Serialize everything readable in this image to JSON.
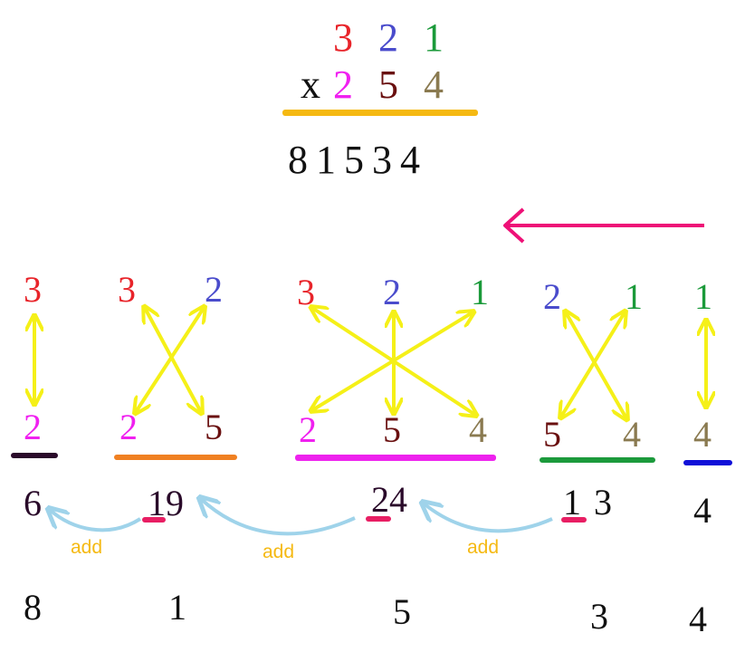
{
  "problem": {
    "top_digits": [
      "3",
      "2",
      "1"
    ],
    "times_sign": "x",
    "bottom_digits": [
      "2",
      "5",
      "4"
    ],
    "result": "8 1 5 3 4"
  },
  "colors": {
    "digit_3": "#e8242a",
    "digit_2_top": "#4a4ccc",
    "digit_1": "#1b9a3a",
    "digit_2_bottom": "#f020f0",
    "digit_5": "#6a1010",
    "digit_4": "#8a7a50",
    "answer_underline": "#f5b912",
    "direction_arrow": "#ee1177",
    "cross_arrows": "#f5f018",
    "carry_arrows": "#9fd3ea",
    "carry_mark": "#e81e63",
    "add_label": "#f5b912",
    "underline_col1": "#2a0a2a",
    "underline_col2": "#f08022",
    "underline_col3": "#ee22ee",
    "underline_col4": "#1c9a3c",
    "underline_col5": "#1010d8"
  },
  "steps": [
    {
      "top": [
        "3"
      ],
      "bottom": [
        "2"
      ],
      "partial": "6",
      "final": "8"
    },
    {
      "top": [
        "3",
        "2"
      ],
      "bottom": [
        "2",
        "5"
      ],
      "partial": "19",
      "final": "1"
    },
    {
      "top": [
        "3",
        "2",
        "1"
      ],
      "bottom": [
        "2",
        "5",
        "4"
      ],
      "partial": "24",
      "final": "5"
    },
    {
      "top": [
        "2",
        "1"
      ],
      "bottom": [
        "5",
        "4"
      ],
      "partial": "1 3",
      "final": "3"
    },
    {
      "top": [
        "1"
      ],
      "bottom": [
        "4"
      ],
      "partial": "4",
      "final": "4"
    }
  ],
  "add_labels": [
    "add",
    "add",
    "add"
  ]
}
